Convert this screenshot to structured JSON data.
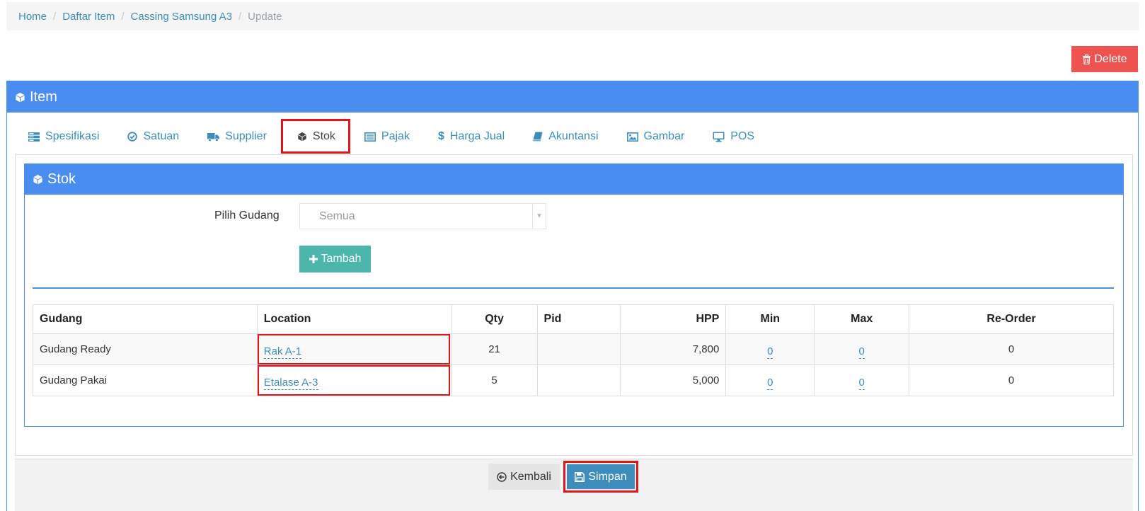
{
  "breadcrumb": {
    "items": [
      "Home",
      "Daftar Item",
      "Cassing Samsung A3"
    ],
    "active": "Update"
  },
  "toolbar": {
    "delete_label": "Delete"
  },
  "panel": {
    "title": "Item"
  },
  "tabs": [
    {
      "label": "Spesifikasi",
      "icon": "server-icon"
    },
    {
      "label": "Satuan",
      "icon": "check-circle-icon"
    },
    {
      "label": "Supplier",
      "icon": "truck-icon"
    },
    {
      "label": "Stok",
      "icon": "cube-icon",
      "active": true
    },
    {
      "label": "Pajak",
      "icon": "list-alt-icon"
    },
    {
      "label": "Harga Jual",
      "icon": "dollar-icon"
    },
    {
      "label": "Akuntansi",
      "icon": "book-icon"
    },
    {
      "label": "Gambar",
      "icon": "image-icon"
    },
    {
      "label": "POS",
      "icon": "monitor-icon"
    }
  ],
  "stok": {
    "title": "Stok",
    "gudang_label": "Pilih Gudang",
    "gudang_value": "Semua",
    "tambah_label": "Tambah",
    "columns": [
      "Gudang",
      "Location",
      "Qty",
      "Pid",
      "HPP",
      "Min",
      "Max",
      "Re-Order"
    ],
    "rows": [
      {
        "gudang": "Gudang Ready",
        "location": "Rak A-1",
        "qty": "21",
        "pid": "",
        "hpp": "7,800",
        "min": "0",
        "max": "0",
        "reorder": "0"
      },
      {
        "gudang": "Gudang Pakai",
        "location": "Etalase A-3",
        "qty": "5",
        "pid": "",
        "hpp": "5,000",
        "min": "0",
        "max": "0",
        "reorder": "0"
      }
    ]
  },
  "footer": {
    "back_label": "Kembali",
    "save_label": "Simpan"
  },
  "colors": {
    "primary": "#4a8df0",
    "danger": "#ef5350",
    "success": "#4cb6ac",
    "link": "#3c8dbc",
    "highlight": "#e0161c"
  }
}
